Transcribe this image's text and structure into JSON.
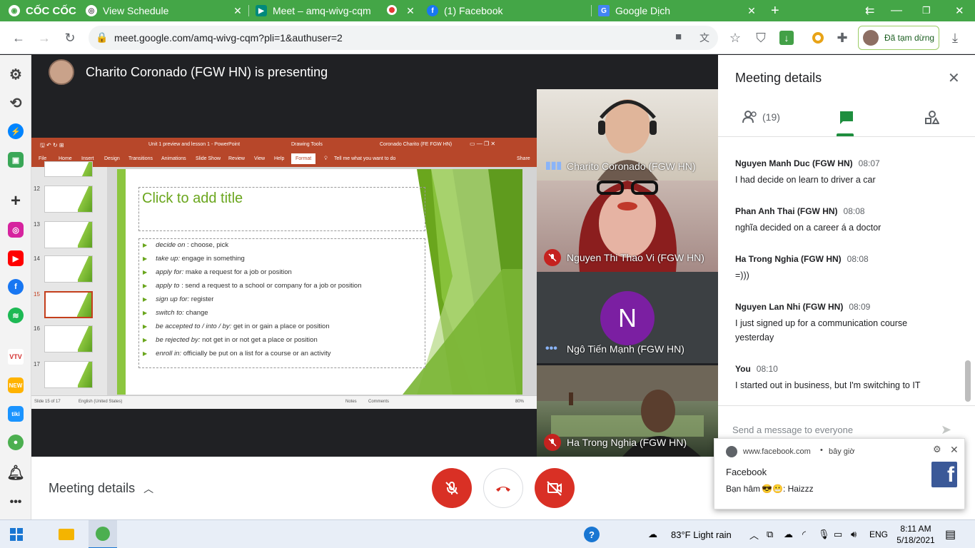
{
  "browser": {
    "brand": "CỐC CỐC",
    "tabs": [
      {
        "title": "View Schedule"
      },
      {
        "title": "Meet – amq-wivg-cqm"
      },
      {
        "title": "(1) Facebook"
      },
      {
        "title": "Google Dịch"
      }
    ],
    "url": "meet.google.com/amq-wivg-cqm?pli=1&authuser=2",
    "profile_label": "Đã tạm dừng"
  },
  "meet": {
    "presenting_text": "Charito Coronado (FGW HN) is presenting",
    "participants": [
      {
        "name": "Charito Coronado (FGW HN)",
        "mic": "speaking"
      },
      {
        "name": "Nguyen Thi Thao Vi (FGW HN)",
        "mic": "muted"
      },
      {
        "name": "Ngô Tiến Mạnh (FGW HN)",
        "mic": "more",
        "initial": "N"
      },
      {
        "name": "Ha Trong Nghia (FGW HN)",
        "mic": "muted"
      }
    ],
    "bottom": {
      "details_label": "Meeting details"
    }
  },
  "ppt": {
    "window_title": "Unit 1 preview and lesson 1  -  PowerPoint",
    "context_tab": "Drawing Tools",
    "user": "Coronado Charito (FE FGW HN)",
    "ribbon_tabs": [
      "File",
      "Home",
      "Insert",
      "Design",
      "Transitions",
      "Animations",
      "Slide Show",
      "Review",
      "View",
      "Help",
      "Format"
    ],
    "tell_me": "Tell me what you want to do",
    "share": "Share",
    "thumbs": [
      "12",
      "13",
      "14",
      "15",
      "16",
      "17"
    ],
    "slide_title_placeholder": "Click to add title",
    "bullets": [
      {
        "term": "decide on",
        "sep": " : ",
        "def": "choose, pick"
      },
      {
        "term": "take up:",
        "sep": " ",
        "def": "engage in something"
      },
      {
        "term": "apply for:",
        "sep": " ",
        "def": "make a request for a job or position"
      },
      {
        "term": "apply to",
        "sep": " : ",
        "def": "send a request to a school or company for a job or position"
      },
      {
        "term": "sign up for:",
        "sep": " ",
        "def": "register"
      },
      {
        "term": "switch to:",
        "sep": " ",
        "def": "change"
      },
      {
        "term": "be accepted to / into / by:",
        "sep": " ",
        "def": "get in or gain a place or position"
      },
      {
        "term": "be rejected by:",
        "sep": " ",
        "def": "not get in or not get a place or position"
      },
      {
        "term": "enroll in:",
        "sep": " ",
        "def": "officially be put on a list for a course or an activity"
      }
    ],
    "status": {
      "slide": "Slide 15 of 17",
      "lang": "English (United States)",
      "notes": "Notes",
      "comments": "Comments",
      "zoom": "80%"
    }
  },
  "panel": {
    "title": "Meeting details",
    "people_count": "(19)",
    "messages": [
      {
        "sender": "Nguyen Manh Duc (FGW HN)",
        "time": "08:07",
        "text": "I had decide on learn to driver a car"
      },
      {
        "sender": "Phan Anh Thai (FGW HN)",
        "time": "08:08",
        "text": "nghĩa decided on a career á a doctor"
      },
      {
        "sender": "Ha Trong Nghia (FGW HN)",
        "time": "08:08",
        "text": "=)))"
      },
      {
        "sender": "Nguyen Lan Nhi (FGW HN)",
        "time": "08:09",
        "text": "I just signed up for a communication course yesterday"
      },
      {
        "sender": "You",
        "time": "08:10",
        "text": "I started out in business, but I'm switching to IT"
      }
    ],
    "input_placeholder": "Send a message to everyone"
  },
  "notification": {
    "source": "www.facebook.com",
    "when": "bây giờ",
    "title": "Facebook",
    "body_prefix": "Bạn hâm",
    "body_suffix": ": Haizzz"
  },
  "taskbar": {
    "weather": "83°F  Light rain",
    "lang": "ENG",
    "time": "8:11 AM",
    "date": "5/18/2021"
  },
  "colors": {
    "coccoc_green": "#44a647",
    "meet_dark": "#202124",
    "end_red": "#d93025",
    "ppt_orange": "#b7472a",
    "slide_green": "#8cc63f"
  }
}
